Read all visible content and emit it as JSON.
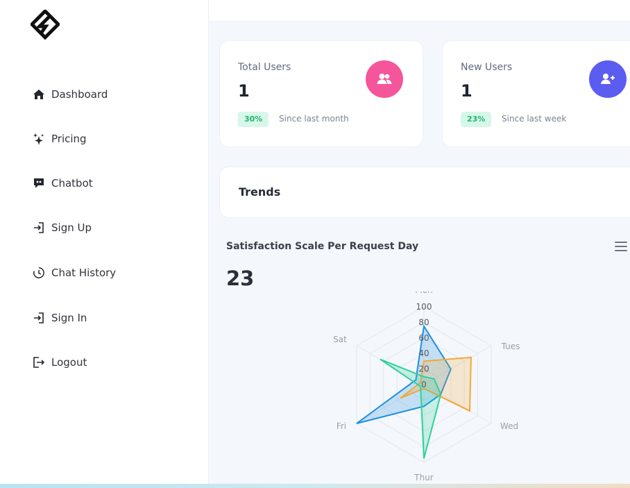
{
  "nav": {
    "items": [
      {
        "label": "Dashboard",
        "icon": "home-icon"
      },
      {
        "label": "Pricing",
        "icon": "sparkle-icon"
      },
      {
        "label": "Chatbot",
        "icon": "chat-bubble-icon"
      },
      {
        "label": "Sign Up",
        "icon": "sign-in-arrow-icon"
      },
      {
        "label": "Chat History",
        "icon": "clock-history-icon"
      },
      {
        "label": "Sign In",
        "icon": "sign-in-arrow-icon"
      },
      {
        "label": "Logout",
        "icon": "logout-icon"
      }
    ]
  },
  "cards": {
    "total_users": {
      "title": "Total Users",
      "value": "1",
      "badge": "30%",
      "since": "Since last month",
      "icon": "users-icon",
      "icon_color": "#f5559a"
    },
    "new_users": {
      "title": "New Users",
      "value": "1",
      "badge": "23%",
      "since": "Since last week",
      "icon": "user-plus-icon",
      "icon_color": "#5b5cf0"
    }
  },
  "trends": {
    "title": "Trends"
  },
  "chart_section": {
    "title": "Satisfaction Scale Per Request Day",
    "value": "23",
    "menu_icon": "hamburger-menu-icon"
  },
  "chart_data": {
    "type": "radar",
    "categories": [
      "Mon",
      "Tues",
      "Wed",
      "Thur",
      "Fri",
      "Sat"
    ],
    "tick_labels": [
      "100",
      "80",
      "60",
      "40",
      "20",
      "0"
    ],
    "rlim": [
      0,
      100
    ],
    "grid": true,
    "series": [
      {
        "color": "#1a8fe0",
        "values": [
          75,
          40,
          25,
          28,
          100,
          12
        ]
      },
      {
        "color": "#f2a833",
        "values": [
          30,
          70,
          68,
          5,
          35,
          5
        ]
      },
      {
        "color": "#2ed19a",
        "values": [
          10,
          15,
          25,
          95,
          5,
          65
        ]
      }
    ]
  }
}
